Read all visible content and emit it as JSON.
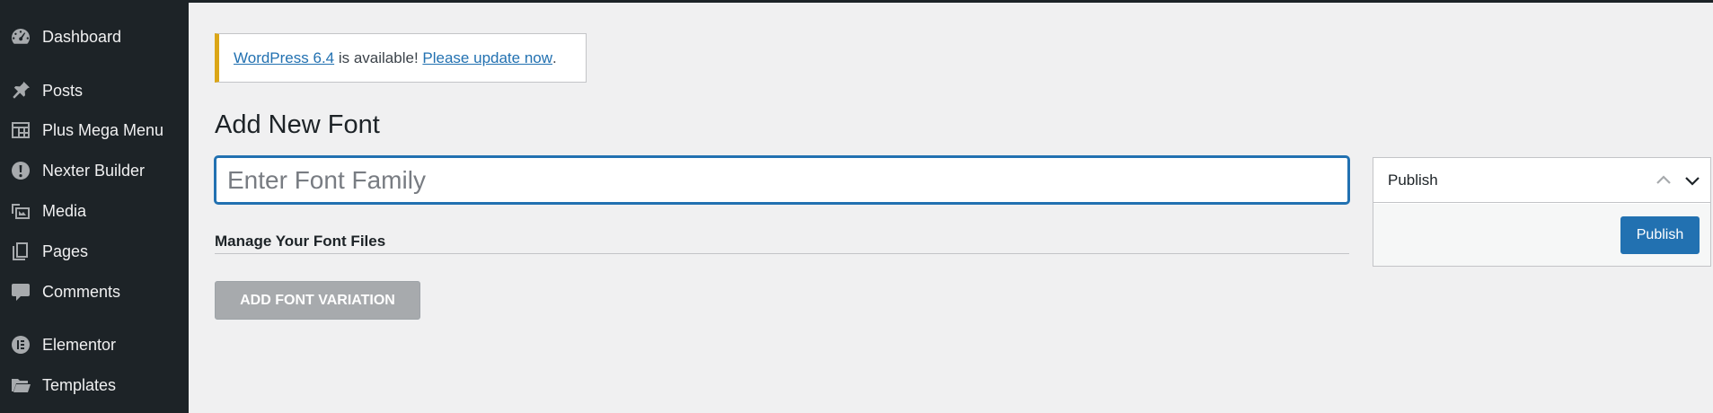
{
  "sidebar": {
    "items": [
      {
        "label": "Dashboard",
        "icon": "dashboard-icon"
      },
      {
        "label": "Posts",
        "icon": "pin-icon"
      },
      {
        "label": "Plus Mega Menu",
        "icon": "mega-menu-icon"
      },
      {
        "label": "Nexter Builder",
        "icon": "alert-icon"
      },
      {
        "label": "Media",
        "icon": "media-icon"
      },
      {
        "label": "Pages",
        "icon": "pages-icon"
      },
      {
        "label": "Comments",
        "icon": "comment-icon"
      },
      {
        "label": "Elementor",
        "icon": "elementor-icon"
      },
      {
        "label": "Templates",
        "icon": "folder-icon"
      }
    ]
  },
  "notice": {
    "version_link": "WordPress 6.4",
    "middle_text": " is available! ",
    "update_link": "Please update now",
    "end_text": "."
  },
  "page": {
    "title": "Add New Font"
  },
  "font_input": {
    "placeholder": "Enter Font Family",
    "value": ""
  },
  "font_files": {
    "heading": "Manage Your Font Files",
    "add_button": "ADD FONT VARIATION"
  },
  "publish": {
    "heading": "Publish",
    "button": "Publish"
  },
  "colors": {
    "sidebar_bg": "#1d2327",
    "accent": "#2271b1",
    "notice_warning": "#dba617",
    "disabled_button": "#a7aaad"
  }
}
